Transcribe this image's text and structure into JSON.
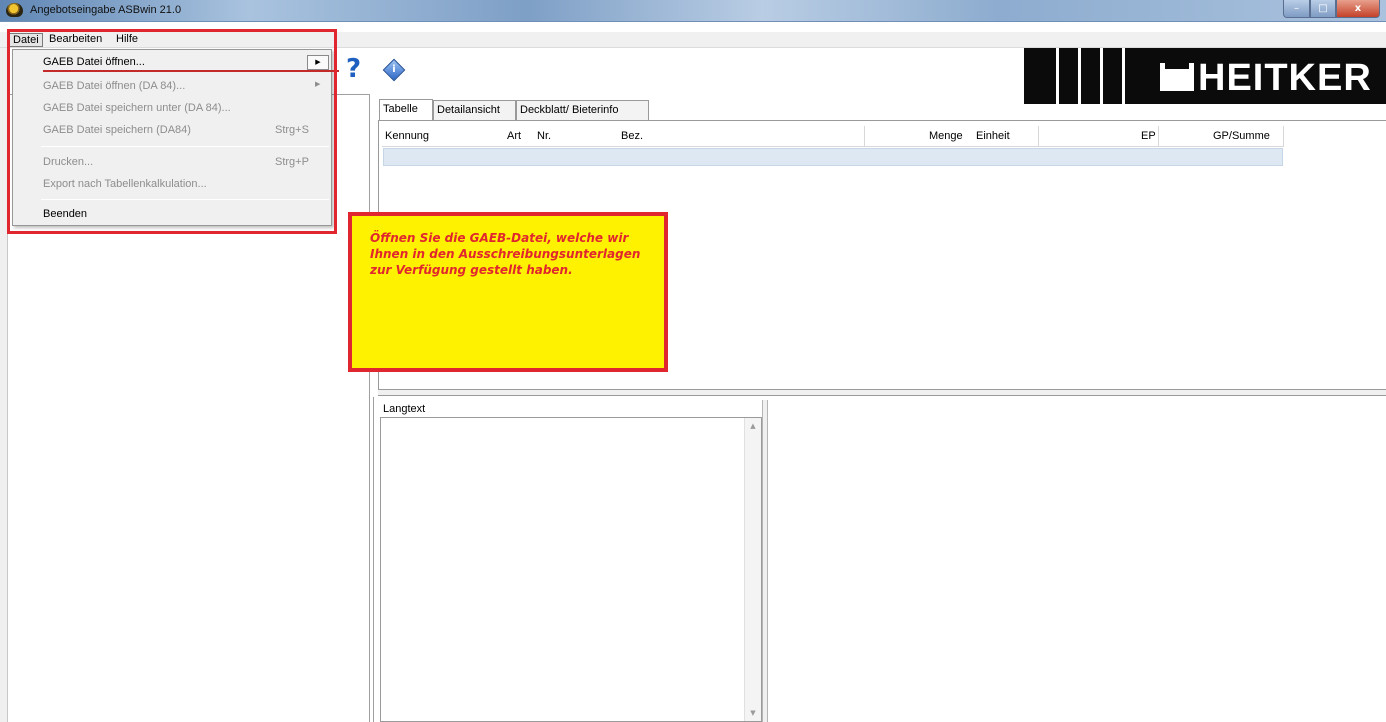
{
  "window": {
    "title": "Angebotseingabe ASBwin 21.0",
    "controls": {
      "minimize": "–",
      "maximize": "□",
      "close": "x"
    }
  },
  "menubar": {
    "items": [
      "Datei",
      "Bearbeiten",
      "Hilfe"
    ],
    "active": "Datei"
  },
  "datei_menu": {
    "items": [
      {
        "label": "GAEB Datei öffnen...",
        "shortcut": "",
        "submenu": true,
        "enabled": true,
        "highlighted": true
      },
      {
        "label": "GAEB Datei öffnen (DA 84)...",
        "shortcut": "",
        "submenu": true,
        "enabled": false
      },
      {
        "label": "GAEB Datei speichern unter (DA 84)...",
        "shortcut": "",
        "submenu": false,
        "enabled": false
      },
      {
        "label": "GAEB Datei speichern (DA84)",
        "shortcut": "Strg+S",
        "submenu": false,
        "enabled": false
      },
      {
        "label": "Drucken...",
        "shortcut": "Strg+P",
        "submenu": false,
        "enabled": false
      },
      {
        "label": "Export nach Tabellenkalkulation...",
        "shortcut": "",
        "submenu": false,
        "enabled": false
      },
      {
        "label": "Beenden",
        "shortcut": "",
        "submenu": false,
        "enabled": true
      }
    ]
  },
  "toolbar": {
    "help_icon": "?",
    "info_icon": "i"
  },
  "logo": {
    "text": "HEITKER"
  },
  "tabs": [
    "Tabelle",
    "Detailansicht",
    "Deckblatt/ Bieterinfo"
  ],
  "active_tab": "Tabelle",
  "table": {
    "columns": [
      "Kennung",
      "Art",
      "Nr.",
      "Bez.",
      "Menge",
      "Einheit",
      "EP",
      "GP/Summe"
    ],
    "rows": []
  },
  "langtext": {
    "label": "Langtext",
    "content": ""
  },
  "note": {
    "text": "Öffnen Sie die GAEB-Datei, welche wir Ihnen in den Ausschreibungsunterlagen zur Verfügung gestellt haben."
  },
  "colors": {
    "annotation_red": "#e0262e",
    "note_yellow": "#fff200",
    "selection_row": "#dde8f3"
  }
}
